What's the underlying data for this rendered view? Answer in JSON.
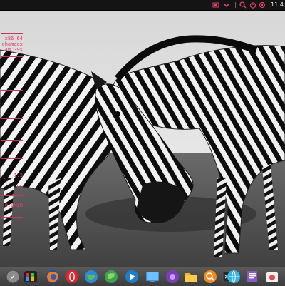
{
  "top_panel": {
    "tray_icons": [
      "updates-icon",
      "chevron-down-icon",
      "search-icon",
      "power-icon",
      "settings-icon"
    ],
    "clock": "11:4",
    "accent": "#e0406a"
  },
  "conky": {
    "arch": "x86_64",
    "user": "ohamedx",
    "uptime": "4m 39s",
    "cpu_freq": "1.3",
    "cpu_percent": "0%",
    "ram_used": "0.0MiB"
  },
  "dock": {
    "items": [
      {
        "name": "launchpad-icon"
      },
      {
        "name": "terminal-apps-icon"
      },
      {
        "name": "firefox-icon"
      },
      {
        "name": "opera-icon"
      },
      {
        "name": "network-globe-icon"
      },
      {
        "name": "world-map-icon"
      },
      {
        "name": "media-player-icon"
      },
      {
        "name": "desktop-icon"
      },
      {
        "name": "purple-app-icon"
      },
      {
        "name": "files-folder-icon"
      },
      {
        "name": "search-tool-icon"
      },
      {
        "name": "terminal-icon"
      },
      {
        "name": "settings-globe-icon"
      },
      {
        "name": "text-editor-icon"
      },
      {
        "name": "software-center-icon"
      },
      {
        "name": "trash-icon"
      }
    ]
  }
}
